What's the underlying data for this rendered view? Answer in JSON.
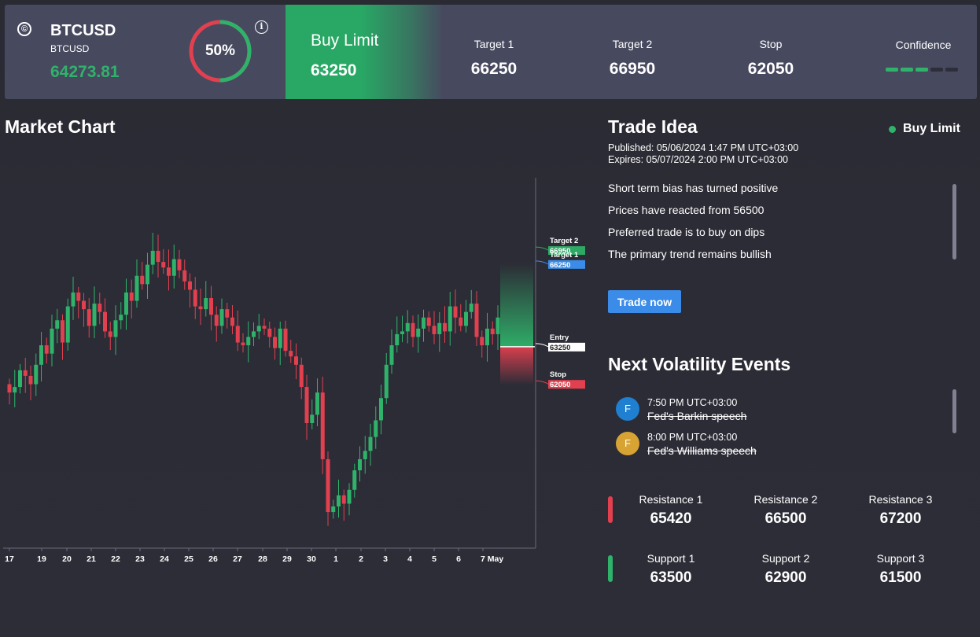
{
  "header": {
    "symbol": "BTCUSD",
    "symbol_sub": "BTCUSD",
    "price": "64273.81",
    "confidence_percent": 50,
    "confidence_text": "50%",
    "order_type": "Buy Limit",
    "entry": "63250",
    "target1_label": "Target 1",
    "target1": "66250",
    "target2_label": "Target 2",
    "target2": "66950",
    "stop_label": "Stop",
    "stop": "62050",
    "confidence_label": "Confidence",
    "confidence_bars_filled": 3,
    "confidence_bars_total": 5
  },
  "market_chart": {
    "title": "Market Chart"
  },
  "chart_data": {
    "type": "candlestick",
    "x_tick_labels": [
      "17",
      "19",
      "20",
      "21",
      "22",
      "23",
      "24",
      "25",
      "26",
      "27",
      "28",
      "29",
      "30",
      "1",
      "2",
      "3",
      "4",
      "5",
      "6",
      "7 May"
    ],
    "ylim": [
      56000,
      69500
    ],
    "levels": [
      {
        "label": "Target 2",
        "value": 66950
      },
      {
        "label": "Target 1",
        "value": 66250
      },
      {
        "label": "Entry",
        "value": 63250
      },
      {
        "label": "Stop",
        "value": 62050
      }
    ],
    "close": [
      61600,
      61800,
      62400,
      62200,
      61900,
      62600,
      63300,
      63000,
      63900,
      64200,
      63400,
      64700,
      65200,
      64900,
      64600,
      64000,
      64800,
      64500,
      63800,
      63600,
      64200,
      64400,
      65200,
      64900,
      65800,
      65500,
      66200,
      66700,
      66300,
      66100,
      65800,
      66400,
      66000,
      65600,
      65300,
      64700,
      64600,
      65000,
      64400,
      64000,
      64600,
      64300,
      64000,
      63400,
      63300,
      63600,
      63800,
      64000,
      63900,
      63600,
      63200,
      63900,
      63100,
      62900,
      62600,
      61800,
      60500,
      60800,
      61600,
      59200,
      57300,
      57500,
      57900,
      57600,
      58100,
      58800,
      59200,
      59500,
      60000,
      60600,
      61400,
      62600,
      63300,
      63700,
      63800,
      64100,
      63600,
      63900,
      64300,
      64000,
      63700,
      64100,
      63800,
      64700,
      64300,
      64000,
      64500,
      64800,
      63600,
      63300,
      63900,
      63700,
      64300
    ]
  },
  "trade_idea": {
    "title": "Trade Idea",
    "status": "Buy Limit",
    "published_label": "Published:",
    "published": "05/06/2024 1:47 PM UTC+03:00",
    "expires_label": "Expires:",
    "expires": "05/07/2024 2:00 PM UTC+03:00",
    "points": [
      "Short term bias has turned positive",
      "Prices have reacted from 56500",
      "Preferred trade is to buy on dips",
      "The primary trend remains bullish"
    ],
    "trade_button": "Trade now"
  },
  "volatility": {
    "title": "Next Volatility Events",
    "events": [
      {
        "initial": "F",
        "time": "7:50 PM UTC+03:00",
        "name": "Fed's Barkin speech",
        "color": "#1f7fd1"
      },
      {
        "initial": "F",
        "time": "8:00 PM UTC+03:00",
        "name": "Fed's Williams speech",
        "color": "#d7a434"
      }
    ]
  },
  "levels": {
    "resistance": [
      {
        "label": "Resistance 1",
        "value": "65420"
      },
      {
        "label": "Resistance 2",
        "value": "66500"
      },
      {
        "label": "Resistance 3",
        "value": "67200"
      }
    ],
    "support": [
      {
        "label": "Support 1",
        "value": "63500"
      },
      {
        "label": "Support 2",
        "value": "62900"
      },
      {
        "label": "Support 3",
        "value": "61500"
      }
    ]
  },
  "colors": {
    "up": "#2fb36a",
    "down": "#e2404f",
    "target1": "#3a8ce8",
    "target2": "#2ea865",
    "header_bg": "#474a5f",
    "accent": "#3a8ce8"
  }
}
